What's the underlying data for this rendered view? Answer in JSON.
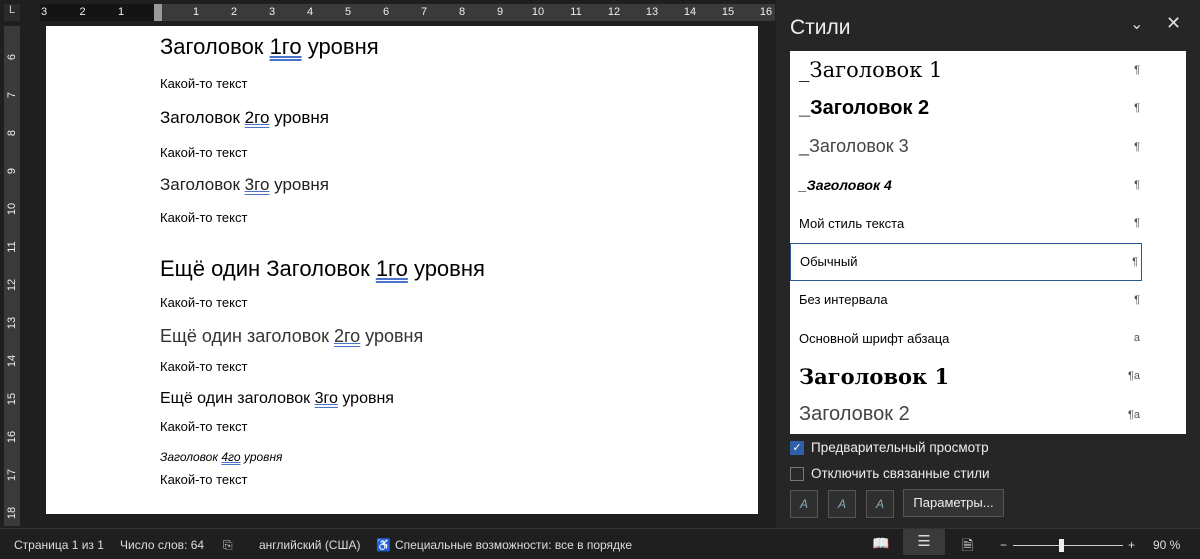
{
  "ruler": {
    "h_left": [
      "3",
      "2",
      "1"
    ],
    "h_right": [
      "1",
      "2",
      "3",
      "4",
      "5",
      "6",
      "7",
      "8",
      "9",
      "10",
      "11",
      "12",
      "13",
      "14",
      "15",
      "16"
    ],
    "v": [
      "6",
      "7",
      "8",
      "9",
      "10",
      "11",
      "12",
      "13",
      "14",
      "15",
      "16",
      "17",
      "18"
    ]
  },
  "document": {
    "lines": [
      {
        "pre": "Заголовок ",
        "u": "1го",
        "post": " уровня"
      },
      {
        "text": "Какой-то текст"
      },
      {
        "pre": "Заголовок ",
        "u": "2го",
        "post": " уровня"
      },
      {
        "text": "Какой-то текст"
      },
      {
        "pre": "Заголовок ",
        "u": "3го",
        "post": " уровня"
      },
      {
        "text": "Какой-то текст"
      },
      {
        "pre": "Ещё один Заголовок ",
        "u": "1го",
        "post": " уровня"
      },
      {
        "text": "Какой-то текст"
      },
      {
        "pre": "Ещё один заголовок ",
        "u": "2го",
        "post": " уровня"
      },
      {
        "text": "Какой-то текст"
      },
      {
        "pre": "Ещё один заголовок ",
        "u": "3го",
        "post": " уровня"
      },
      {
        "text": "Какой-то текст"
      },
      {
        "pre": "Заголовок ",
        "u": "4го",
        "post": " уровня"
      },
      {
        "text": "Какой-то текст"
      }
    ]
  },
  "styles_pane": {
    "title": "Стили",
    "items": [
      {
        "label": "_Заголовок 1",
        "mark": "¶"
      },
      {
        "label": "_Заголовок 2",
        "mark": "¶"
      },
      {
        "label": "_Заголовок 3",
        "mark": "¶"
      },
      {
        "label": "_Заголовок 4",
        "mark": "¶"
      },
      {
        "label": "Мой стиль текста",
        "mark": "¶"
      },
      {
        "label": "Обычный",
        "mark": "¶"
      },
      {
        "label": "Без интервала",
        "mark": "¶"
      },
      {
        "label": "Основной шрифт абзаца",
        "mark": "a"
      },
      {
        "label": "Заголовок 1",
        "mark": "¶a"
      },
      {
        "label": "Заголовок 2",
        "mark": "¶a"
      }
    ],
    "preview_label": "Предварительный просмотр",
    "preview_checked": true,
    "linked_label": "Отключить связанные стили",
    "linked_checked": false,
    "params_button": "Параметры..."
  },
  "status": {
    "page": "Страница 1 из 1",
    "words": "Число слов: 64",
    "language": "английский (США)",
    "accessibility": "Специальные возможности: все в порядке",
    "zoom": "90 %",
    "zoom_minus": "−",
    "zoom_plus": "+"
  }
}
